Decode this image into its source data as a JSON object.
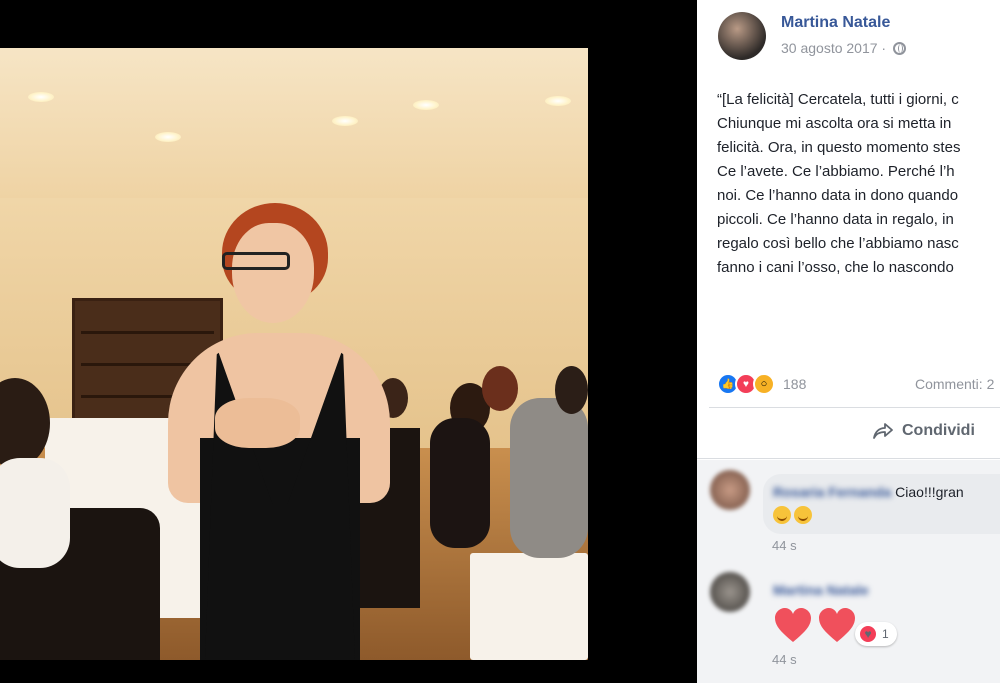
{
  "post": {
    "author": "Martina Natale",
    "date": "30 agosto 2017",
    "privacy_separator": "·",
    "privacy_icon": "globe-icon",
    "text_lines": [
      "“[La felicità] Cercatela, tutti i giorni, c",
      "Chiunque mi ascolta ora si metta in",
      "felicità. Ora, in questo momento stes",
      "Ce l’avete. Ce l’abbiamo. Perché l’h",
      "noi. Ce l’hanno data in dono quando",
      "piccoli. Ce l’hanno data in regalo, in",
      "regalo così bello che l’abbiamo nasc",
      "fanno i cani l’osso, che lo nascondo"
    ],
    "reactions": {
      "icons": [
        "like-icon",
        "love-icon",
        "wow-icon"
      ],
      "count": "188"
    },
    "comments_count": "Commenti: 2",
    "share_label": "Condividi"
  },
  "comments": [
    {
      "author": "Rosaria Fernanda",
      "text": "Ciao!!!gran",
      "time": "44 s"
    },
    {
      "author": "Martina Natale",
      "reaction_count": "1",
      "time": "44 s"
    }
  ],
  "colors": {
    "link": "#385898",
    "meta": "#90949c",
    "comment_bg": "#f2f3f5",
    "love": "#f33e58",
    "like": "#1877f2"
  }
}
